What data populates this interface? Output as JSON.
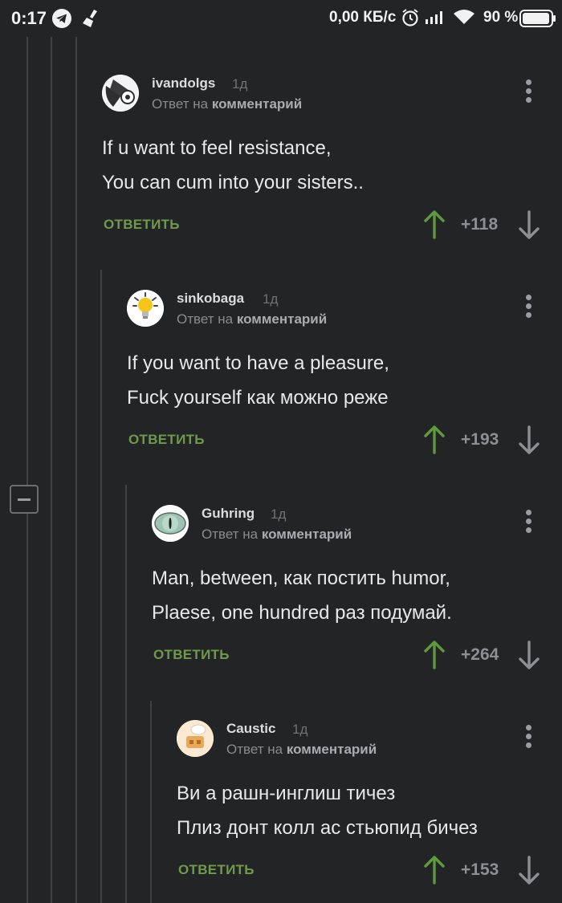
{
  "status_bar": {
    "time": "0:17",
    "network_speed": "0,00 КБ/с",
    "battery": "90 %"
  },
  "comments": [
    {
      "username": "ivandolgs",
      "time": "1д",
      "reply_prefix": "Ответ на",
      "reply_target": "комментарий",
      "line1": "If u want to feel resistance,",
      "line2": "You can cum into your sisters..",
      "reply_label": "ОТВЕТИТЬ",
      "score": "+118"
    },
    {
      "username": "sinkobaga",
      "time": "1д",
      "reply_prefix": "Ответ на",
      "reply_target": "комментарий",
      "line1": "If you want to have a pleasure,",
      "line2": "Fuck yourself как можно реже",
      "reply_label": "ОТВЕТИТЬ",
      "score": "+193"
    },
    {
      "username": "Guhring",
      "time": "1д",
      "reply_prefix": "Ответ на",
      "reply_target": "комментарий",
      "line1": "Man, between, как постить humor,",
      "line2": "Plaese, one hundred раз подумай.",
      "reply_label": "ОТВЕТИТЬ",
      "score": "+264"
    },
    {
      "username": "Caustic",
      "time": "1д",
      "reply_prefix": "Ответ на",
      "reply_target": "комментарий",
      "line1": "Ви а рашн-инглиш тичез",
      "line2": "Плиз донт колл ас стьюпид бичез",
      "reply_label": "ОТВЕТИТЬ",
      "score": "+153"
    }
  ],
  "colors": {
    "background": "#222426",
    "reply_green": "#6f9a4b",
    "upvote_green": "#5f9a3e"
  }
}
